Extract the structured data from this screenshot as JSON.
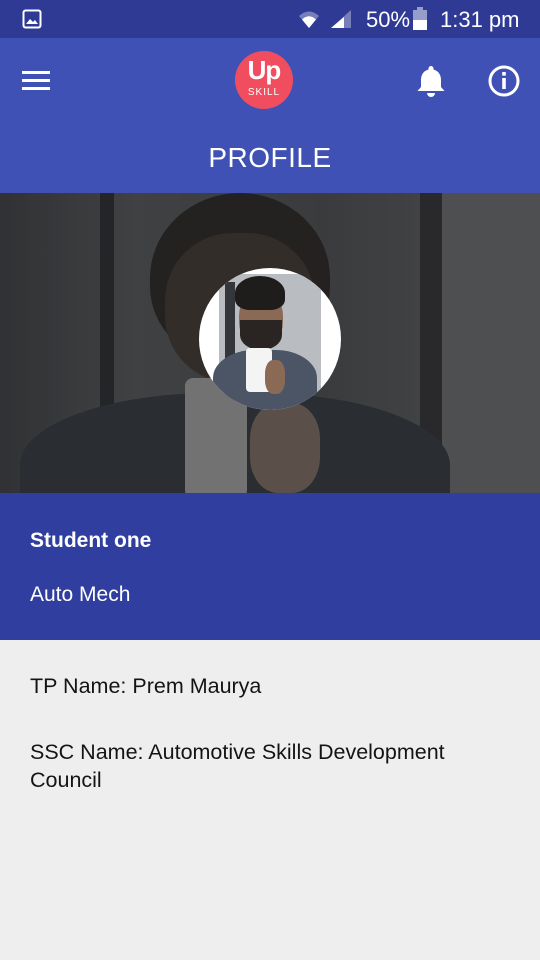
{
  "status_bar": {
    "battery_percent": "50%",
    "time": "1:31 pm",
    "icons": [
      "gallery-icon",
      "wifi-icon",
      "signal-icon",
      "battery-icon"
    ]
  },
  "app_bar": {
    "logo_main": "Up",
    "logo_sub": "SKILL",
    "title": "PROFILE",
    "icons": [
      "menu-icon",
      "bell-icon",
      "info-icon"
    ],
    "accent_color": "#3f51b5",
    "logo_color": "#f04e5e"
  },
  "profile": {
    "name": "Student one",
    "trade": "Auto Mech",
    "tp_name": "TP Name: Prem Maurya",
    "ssc_name": "SSC Name: Automotive Skills Development Council",
    "panel_color": "#303f9f"
  }
}
